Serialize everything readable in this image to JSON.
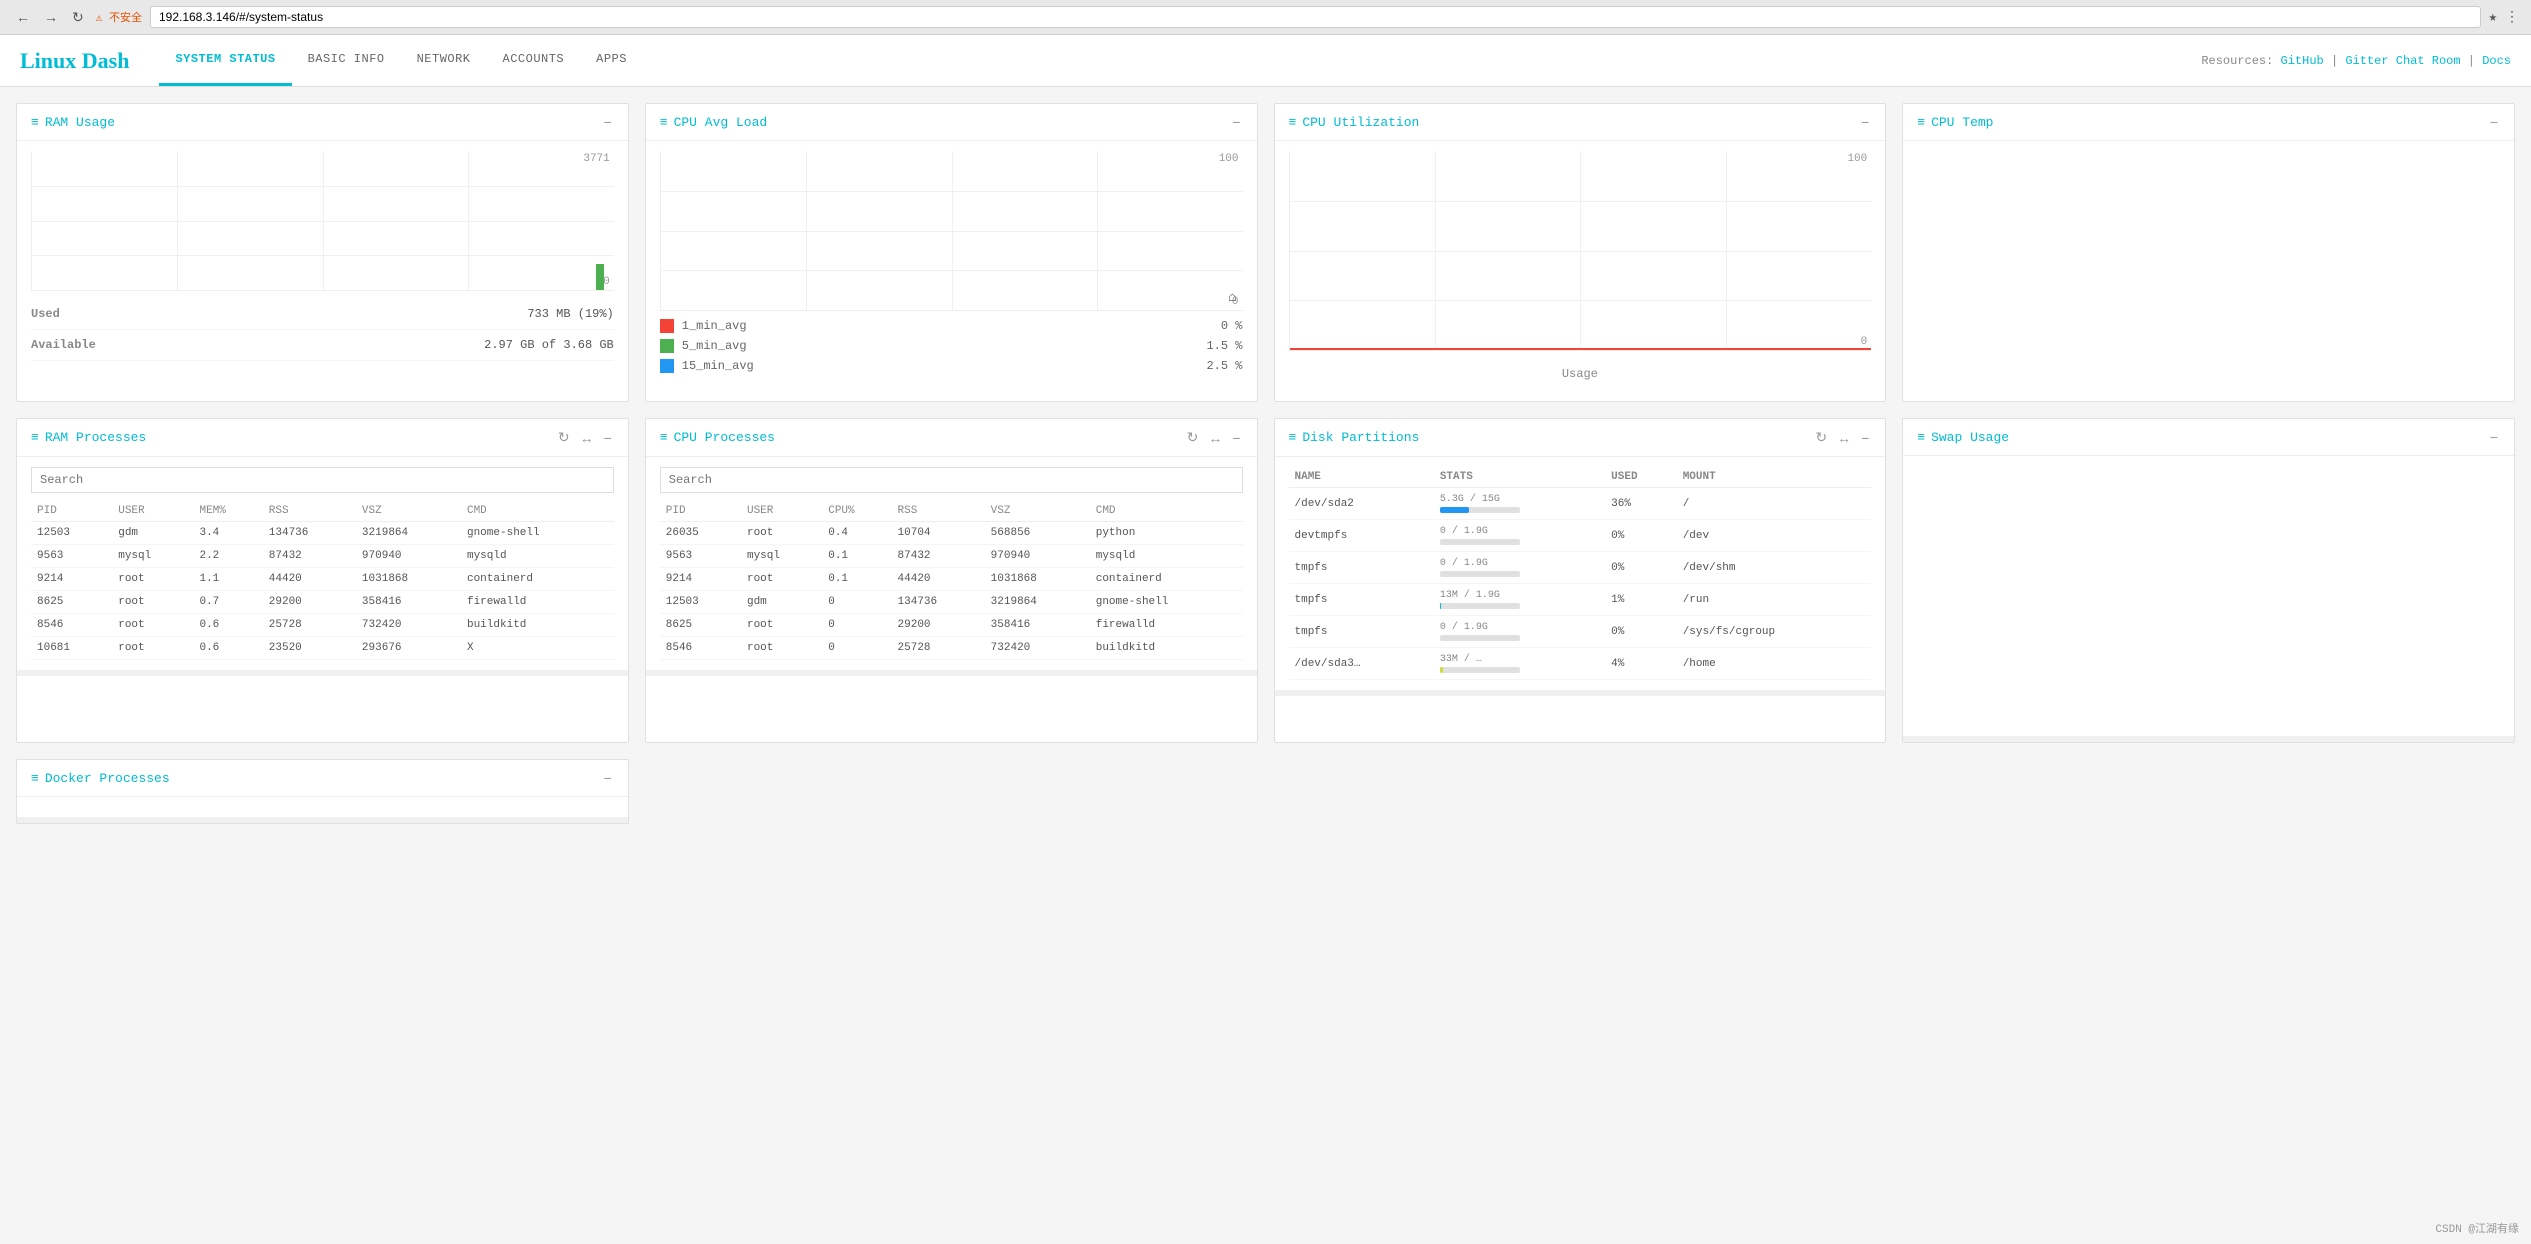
{
  "browser": {
    "url": "192.168.3.146/#/system-status",
    "security_warning": "⚠ 不安全",
    "back_disabled": true,
    "forward_disabled": true
  },
  "header": {
    "logo": "Linux Dash",
    "nav_tabs": [
      {
        "id": "system-status",
        "label": "SYSTEM STATUS",
        "active": true
      },
      {
        "id": "basic-info",
        "label": "BASIC INFO",
        "active": false
      },
      {
        "id": "network",
        "label": "NETWORK",
        "active": false
      },
      {
        "id": "accounts",
        "label": "ACCOUNTS",
        "active": false
      },
      {
        "id": "apps",
        "label": "APPS",
        "active": false
      }
    ],
    "resources_label": "Resources:",
    "resource_links": [
      {
        "label": "GitHub"
      },
      {
        "label": "Gitter Chat Room"
      },
      {
        "label": "Docs"
      }
    ]
  },
  "widgets": {
    "ram_usage": {
      "title": "RAM Usage",
      "chart_max": 3771,
      "chart_min": 0,
      "bar_value": 19,
      "used_label": "Used",
      "used_value": "733 MB (19%)",
      "available_label": "Available",
      "available_value": "2.97 GB of 3.68 GB"
    },
    "cpu_avg_load": {
      "title": "CPU Avg Load",
      "chart_max": 100,
      "chart_min": 0,
      "legend": [
        {
          "color": "#f44336",
          "label": "1_min_avg",
          "value": "0 %"
        },
        {
          "color": "#4caf50",
          "label": "5_min_avg",
          "value": "1.5 %"
        },
        {
          "color": "#2196f3",
          "label": "15_min_avg",
          "value": "2.5 %"
        }
      ]
    },
    "cpu_utilization": {
      "title": "CPU Utilization",
      "chart_max": 100,
      "chart_min": 0,
      "usage_label": "Usage"
    },
    "cpu_temp": {
      "title": "CPU Temp"
    },
    "ram_processes": {
      "title": "RAM Processes",
      "search_placeholder": "Search",
      "columns": [
        "PID",
        "USER",
        "MEM%",
        "RSS",
        "VSZ",
        "CMD"
      ],
      "rows": [
        {
          "pid": "12503",
          "user": "gdm",
          "mem": "3.4",
          "rss": "134736",
          "vsz": "3219864",
          "cmd": "gnome-shell"
        },
        {
          "pid": "9563",
          "user": "mysql",
          "mem": "2.2",
          "rss": "87432",
          "vsz": "970940",
          "cmd": "mysqld"
        },
        {
          "pid": "9214",
          "user": "root",
          "mem": "1.1",
          "rss": "44420",
          "vsz": "1031868",
          "cmd": "containerd"
        },
        {
          "pid": "8625",
          "user": "root",
          "mem": "0.7",
          "rss": "29200",
          "vsz": "358416",
          "cmd": "firewalld"
        },
        {
          "pid": "8546",
          "user": "root",
          "mem": "0.6",
          "rss": "25728",
          "vsz": "732420",
          "cmd": "buildkitd"
        },
        {
          "pid": "10681",
          "user": "root",
          "mem": "0.6",
          "rss": "23520",
          "vsz": "293676",
          "cmd": "X"
        }
      ]
    },
    "cpu_processes": {
      "title": "CPU Processes",
      "search_placeholder": "Search",
      "columns": [
        "PID",
        "USER",
        "CPU%",
        "RSS",
        "VSZ",
        "CMD"
      ],
      "rows": [
        {
          "pid": "26035",
          "user": "root",
          "cpu": "0.4",
          "rss": "10704",
          "vsz": "568856",
          "cmd": "python"
        },
        {
          "pid": "9563",
          "user": "mysql",
          "cpu": "0.1",
          "rss": "87432",
          "vsz": "970940",
          "cmd": "mysqld"
        },
        {
          "pid": "9214",
          "user": "root",
          "cpu": "0.1",
          "rss": "44420",
          "vsz": "1031868",
          "cmd": "containerd"
        },
        {
          "pid": "12503",
          "user": "gdm",
          "cpu": "0",
          "rss": "134736",
          "vsz": "3219864",
          "cmd": "gnome-shell"
        },
        {
          "pid": "8625",
          "user": "root",
          "cpu": "0",
          "rss": "29200",
          "vsz": "358416",
          "cmd": "firewalld"
        },
        {
          "pid": "8546",
          "user": "root",
          "cpu": "0",
          "rss": "25728",
          "vsz": "732420",
          "cmd": "buildkitd"
        }
      ]
    },
    "disk_partitions": {
      "title": "Disk Partitions",
      "columns": [
        "NAME",
        "STATS",
        "USED",
        "MOUNT"
      ],
      "rows": [
        {
          "name": "/dev/sda2",
          "stats": "5.3G / 15G",
          "used_pct": 36,
          "bar_color": "#2196f3",
          "used_label": "36%",
          "mount": "/"
        },
        {
          "name": "devtmpfs",
          "stats": "0 / 1.9G",
          "used_pct": 0,
          "bar_color": "#cddc39",
          "used_label": "0%",
          "mount": "/dev"
        },
        {
          "name": "tmpfs",
          "stats": "0 / 1.9G",
          "used_pct": 0,
          "bar_color": "#cddc39",
          "used_label": "0%",
          "mount": "/dev/shm"
        },
        {
          "name": "tmpfs",
          "stats": "13M / 1.9G",
          "used_pct": 1,
          "bar_color": "#00bcd4",
          "used_label": "1%",
          "mount": "/run"
        },
        {
          "name": "tmpfs",
          "stats": "0 / 1.9G",
          "used_pct": 0,
          "bar_color": "#cddc39",
          "used_label": "0%",
          "mount": "/sys/fs/cgroup"
        },
        {
          "name": "/dev/sda3…",
          "stats": "33M / …",
          "used_pct": 4,
          "bar_color": "#cddc39",
          "used_label": "4%",
          "mount": "/home"
        }
      ]
    },
    "swap_usage": {
      "title": "Swap Usage"
    },
    "docker_processes": {
      "title": "Docker Processes"
    }
  },
  "footer": {
    "watermark": "CSDN @江湖有缘"
  }
}
